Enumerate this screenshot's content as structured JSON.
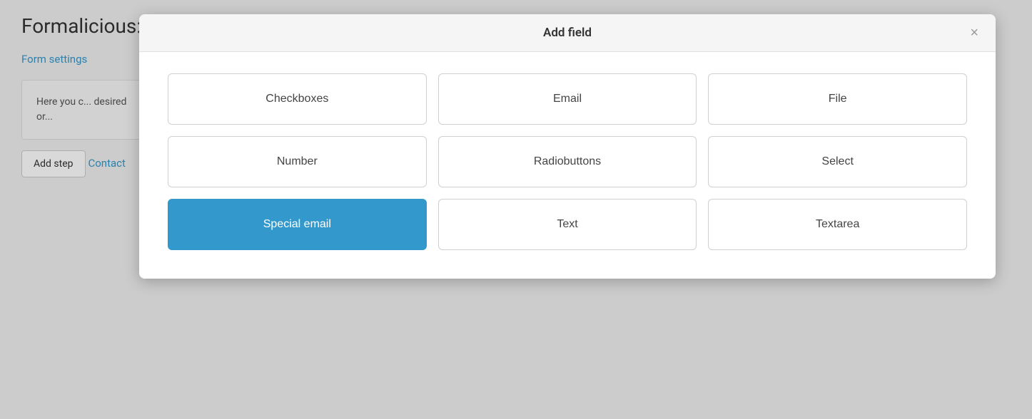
{
  "page": {
    "title": "Formalicious: Contact form",
    "form_settings_label": "Form settings",
    "content_text": "Here you c...\ndesired or...",
    "add_step_label": "Add step",
    "contact_label": "Contact"
  },
  "modal": {
    "title": "Add field",
    "close_label": "×",
    "fields": [
      {
        "id": "checkboxes",
        "label": "Checkboxes",
        "active": false
      },
      {
        "id": "email",
        "label": "Email",
        "active": false
      },
      {
        "id": "file",
        "label": "File",
        "active": false
      },
      {
        "id": "number",
        "label": "Number",
        "active": false
      },
      {
        "id": "radiobuttons",
        "label": "Radiobuttons",
        "active": false
      },
      {
        "id": "select",
        "label": "Select",
        "active": false
      },
      {
        "id": "special-email",
        "label": "Special email",
        "active": true
      },
      {
        "id": "text",
        "label": "Text",
        "active": false
      },
      {
        "id": "textarea",
        "label": "Textarea",
        "active": false
      }
    ]
  }
}
